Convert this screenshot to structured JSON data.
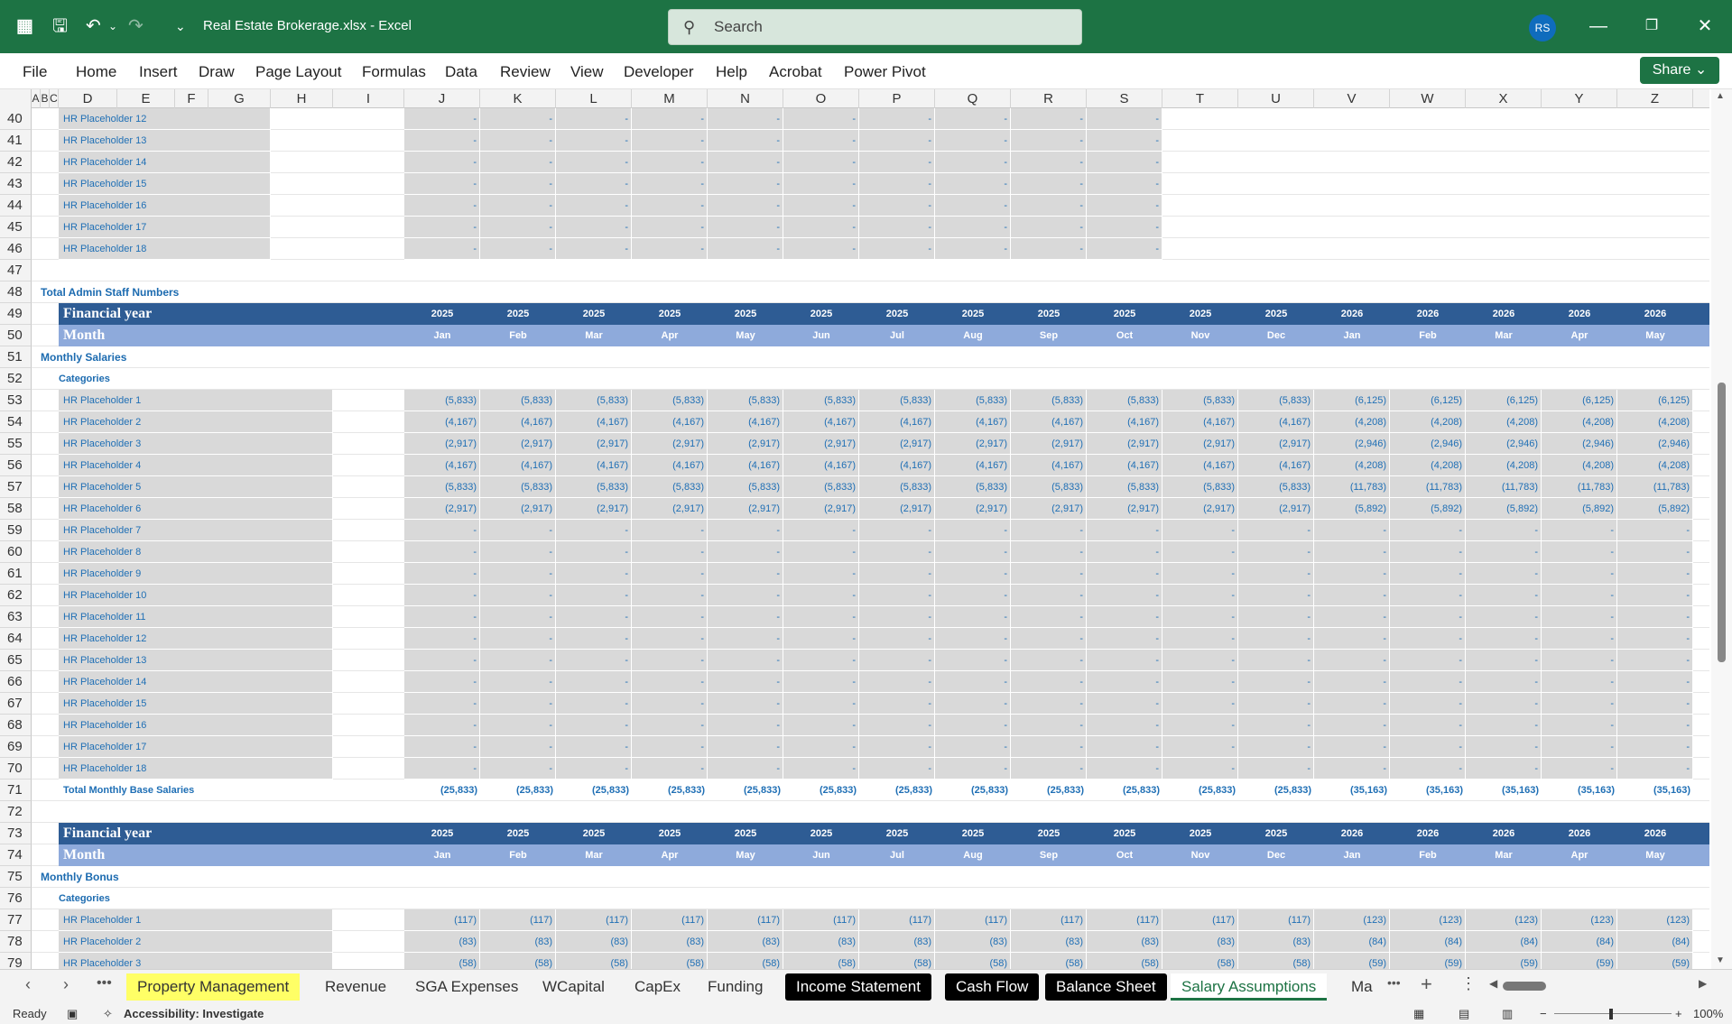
{
  "window": {
    "file_title": "Real Estate Brokerage.xlsx  -  Excel",
    "search_placeholder": "Search",
    "user_initials": "RS"
  },
  "ribbon": {
    "tabs": [
      "File",
      "Home",
      "Insert",
      "Draw",
      "Page Layout",
      "Formulas",
      "Data",
      "Review",
      "View",
      "Developer",
      "Help",
      "Acrobat",
      "Power Pivot"
    ],
    "share_label": "Share"
  },
  "columns": [
    "A",
    "B",
    "C",
    "D",
    "E",
    "F",
    "G",
    "H",
    "I",
    "J",
    "K",
    "L",
    "M",
    "N",
    "O",
    "P",
    "Q",
    "R",
    "S",
    "T",
    "U",
    "V",
    "W",
    "X",
    "Y",
    "Z"
  ],
  "top_block": {
    "rows": [
      40,
      41,
      42,
      43,
      44,
      45,
      46
    ],
    "labels": [
      "HR Placeholder 12",
      "HR Placeholder 13",
      "HR Placeholder 14",
      "HR Placeholder 15",
      "HR Placeholder 16",
      "HR Placeholder 17",
      "HR Placeholder 18"
    ],
    "dash": "-"
  },
  "row47": 47,
  "total_admin": {
    "row": 48,
    "label": "Total Admin Staff Numbers"
  },
  "header_rows": {
    "financial_year_label": "Financial year",
    "month_label": "Month",
    "years": [
      "2025",
      "2025",
      "2025",
      "2025",
      "2025",
      "2025",
      "2025",
      "2025",
      "2025",
      "2025",
      "2025",
      "2025",
      "2026",
      "2026",
      "2026",
      "2026",
      "2026"
    ],
    "months": [
      "Jan",
      "Feb",
      "Mar",
      "Apr",
      "May",
      "Jun",
      "Jul",
      "Aug",
      "Sep",
      "Oct",
      "Nov",
      "Dec",
      "Jan",
      "Feb",
      "Mar",
      "Apr",
      "May"
    ]
  },
  "salaries": {
    "fy_row": 49,
    "month_row": 50,
    "title_row": 51,
    "title": "Monthly Salaries",
    "cat_row": 52,
    "categories": "Categories",
    "rows": [
      53,
      54,
      55,
      56,
      57,
      58,
      59,
      60,
      61,
      62,
      63,
      64,
      65,
      66,
      67,
      68,
      69,
      70
    ],
    "labels": [
      "HR Placeholder 1",
      "HR Placeholder 2",
      "HR Placeholder 3",
      "HR Placeholder 4",
      "HR Placeholder 5",
      "HR Placeholder 6",
      "HR Placeholder 7",
      "HR Placeholder 8",
      "HR Placeholder 9",
      "HR Placeholder 10",
      "HR Placeholder 11",
      "HR Placeholder 12",
      "HR Placeholder 13",
      "HR Placeholder 14",
      "HR Placeholder 15",
      "HR Placeholder 16",
      "HR Placeholder 17",
      "HR Placeholder 18"
    ],
    "values": [
      [
        "(5,833)",
        "(5,833)",
        "(5,833)",
        "(5,833)",
        "(5,833)",
        "(5,833)",
        "(5,833)",
        "(5,833)",
        "(5,833)",
        "(5,833)",
        "(5,833)",
        "(5,833)",
        "(6,125)",
        "(6,125)",
        "(6,125)",
        "(6,125)",
        "(6,125)"
      ],
      [
        "(4,167)",
        "(4,167)",
        "(4,167)",
        "(4,167)",
        "(4,167)",
        "(4,167)",
        "(4,167)",
        "(4,167)",
        "(4,167)",
        "(4,167)",
        "(4,167)",
        "(4,167)",
        "(4,208)",
        "(4,208)",
        "(4,208)",
        "(4,208)",
        "(4,208)"
      ],
      [
        "(2,917)",
        "(2,917)",
        "(2,917)",
        "(2,917)",
        "(2,917)",
        "(2,917)",
        "(2,917)",
        "(2,917)",
        "(2,917)",
        "(2,917)",
        "(2,917)",
        "(2,917)",
        "(2,946)",
        "(2,946)",
        "(2,946)",
        "(2,946)",
        "(2,946)"
      ],
      [
        "(4,167)",
        "(4,167)",
        "(4,167)",
        "(4,167)",
        "(4,167)",
        "(4,167)",
        "(4,167)",
        "(4,167)",
        "(4,167)",
        "(4,167)",
        "(4,167)",
        "(4,167)",
        "(4,208)",
        "(4,208)",
        "(4,208)",
        "(4,208)",
        "(4,208)"
      ],
      [
        "(5,833)",
        "(5,833)",
        "(5,833)",
        "(5,833)",
        "(5,833)",
        "(5,833)",
        "(5,833)",
        "(5,833)",
        "(5,833)",
        "(5,833)",
        "(5,833)",
        "(5,833)",
        "(11,783)",
        "(11,783)",
        "(11,783)",
        "(11,783)",
        "(11,783)"
      ],
      [
        "(2,917)",
        "(2,917)",
        "(2,917)",
        "(2,917)",
        "(2,917)",
        "(2,917)",
        "(2,917)",
        "(2,917)",
        "(2,917)",
        "(2,917)",
        "(2,917)",
        "(2,917)",
        "(5,892)",
        "(5,892)",
        "(5,892)",
        "(5,892)",
        "(5,892)"
      ]
    ],
    "total_row": 71,
    "total_label": "Total Monthly Base Salaries",
    "totals": [
      "(25,833)",
      "(25,833)",
      "(25,833)",
      "(25,833)",
      "(25,833)",
      "(25,833)",
      "(25,833)",
      "(25,833)",
      "(25,833)",
      "(25,833)",
      "(25,833)",
      "(25,833)",
      "(35,163)",
      "(35,163)",
      "(35,163)",
      "(35,163)",
      "(35,163)"
    ]
  },
  "row72": 72,
  "bonus": {
    "fy_row": 73,
    "month_row": 74,
    "title_row": 75,
    "title": "Monthly Bonus",
    "cat_row": 76,
    "categories": "Categories",
    "rows": [
      77,
      78,
      79
    ],
    "labels": [
      "HR Placeholder 1",
      "HR Placeholder 2",
      "HR Placeholder 3"
    ],
    "values": [
      [
        "(117)",
        "(117)",
        "(117)",
        "(117)",
        "(117)",
        "(117)",
        "(117)",
        "(117)",
        "(117)",
        "(117)",
        "(117)",
        "(117)",
        "(123)",
        "(123)",
        "(123)",
        "(123)",
        "(123)"
      ],
      [
        "(83)",
        "(83)",
        "(83)",
        "(83)",
        "(83)",
        "(83)",
        "(83)",
        "(83)",
        "(83)",
        "(83)",
        "(83)",
        "(83)",
        "(84)",
        "(84)",
        "(84)",
        "(84)",
        "(84)"
      ],
      [
        "(58)",
        "(58)",
        "(58)",
        "(58)",
        "(58)",
        "(58)",
        "(58)",
        "(58)",
        "(58)",
        "(58)",
        "(58)",
        "(58)",
        "(59)",
        "(59)",
        "(59)",
        "(59)",
        "(59)"
      ]
    ]
  },
  "sheet_tabs": [
    {
      "label": "Property Management",
      "style": "yel"
    },
    {
      "label": "Revenue",
      "style": ""
    },
    {
      "label": "SGA Expenses",
      "style": ""
    },
    {
      "label": "WCapital",
      "style": ""
    },
    {
      "label": "CapEx",
      "style": ""
    },
    {
      "label": "Funding",
      "style": ""
    },
    {
      "label": "Income Statement",
      "style": "blk"
    },
    {
      "label": "Cash Flow",
      "style": "blk"
    },
    {
      "label": "Balance Sheet",
      "style": "blk"
    },
    {
      "label": "Salary Assumptions",
      "style": "act"
    },
    {
      "label": "Ma",
      "style": ""
    }
  ],
  "status": {
    "ready": "Ready",
    "accessibility": "Accessibility: Investigate",
    "zoom": "100%"
  }
}
